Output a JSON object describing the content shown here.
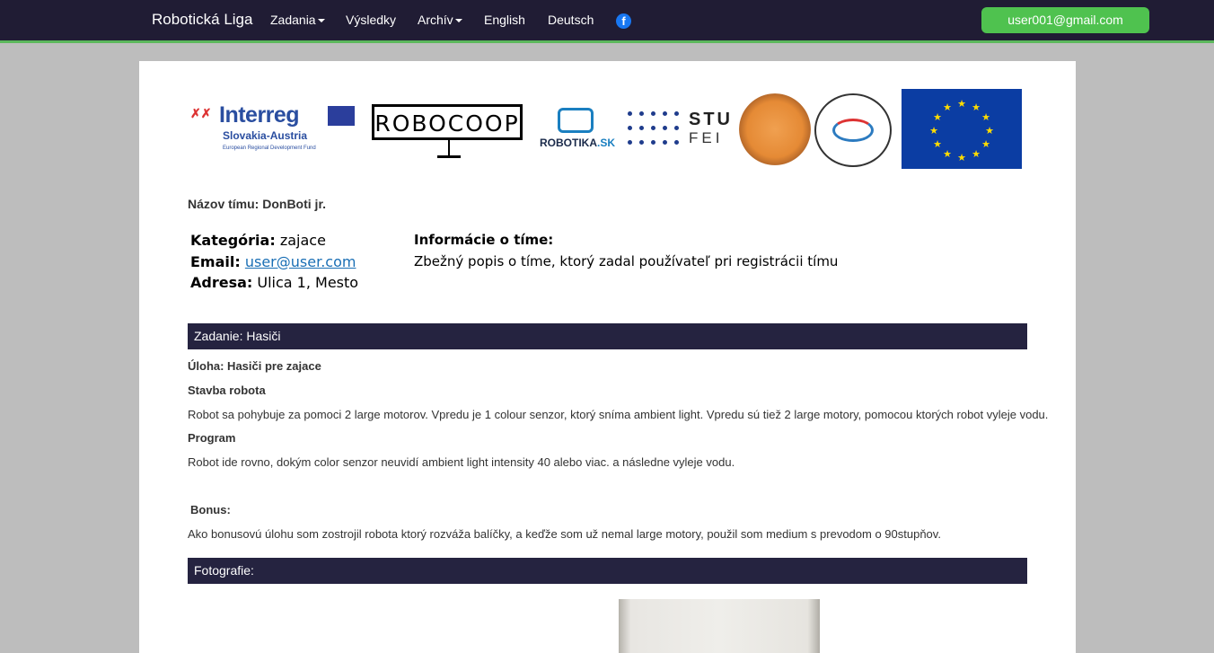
{
  "navbar": {
    "brand": "Robotická Liga",
    "items": [
      {
        "label": "Zadania",
        "dropdown": true
      },
      {
        "label": "Výsledky",
        "dropdown": false
      },
      {
        "label": "Archív",
        "dropdown": true
      },
      {
        "label": "English",
        "dropdown": false
      },
      {
        "label": "Deutsch",
        "dropdown": false
      }
    ],
    "facebook_icon": "facebook-icon",
    "user_email": "user001@gmail.com"
  },
  "logos": {
    "interreg": {
      "name": "Interreg",
      "subtitle": "Slovakia-Austria",
      "fund": "European Regional Development Fund"
    },
    "robocoop": "ROBOCOOP",
    "robotika": {
      "prefix": "ROBOTIKA",
      "suffix": ".SK"
    },
    "stu": "STU",
    "fei": "FEI"
  },
  "team": {
    "name_label": "Názov tímu:",
    "name": "DonBoti jr.",
    "category_label": "Kategória:",
    "category": "zajace",
    "email_label": "Email:",
    "email": "user@user.com",
    "address_label": "Adresa:",
    "address": "Ulica 1, Mesto",
    "info_label": "Informácie o tíme:",
    "info": "Zbežný popis o tíme, ktorý zadal používateľ pri registrácii tímu"
  },
  "assignment": {
    "header": "Zadanie: Hasiči",
    "task": "Úloha: Hasiči pre zajace",
    "build_heading": "Stavba robota",
    "build_text": "Robot sa pohybuje za pomoci 2 large motorov. Vpredu je 1 colour senzor, ktorý sníma ambient light. Vpredu sú tiež 2 large motory, pomocou ktorých robot vyleje vodu.",
    "program_heading": "Program",
    "program_text": "Robot ide rovno, dokým color senzor neuvidí ambient light intensity 40 alebo viac. a následne vyleje vodu.",
    "bonus_heading": "Bonus:",
    "bonus_text": "Ako bonusovú úlohu som zostrojil robota ktorý rozváža balíčky, a keďže som už nemal large motory, použil som medium s prevodom o 90stupňov."
  },
  "photos": {
    "header": "Fotografie:"
  },
  "colors": {
    "navbar_bg": "#201c34",
    "accent_green": "#5cb85c",
    "section_bar": "#252340",
    "link": "#1a6fb5"
  }
}
